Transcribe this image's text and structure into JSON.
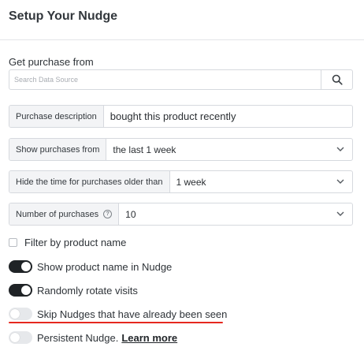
{
  "header": {
    "title": "Setup Your Nudge"
  },
  "purchase_source": {
    "label": "Get purchase from",
    "search_placeholder": "Search Data Source",
    "search_icon": "search-icon"
  },
  "fields": {
    "description": {
      "label": "Purchase description",
      "value": "bought this product recently"
    },
    "show_from": {
      "label": "Show purchases from",
      "value": "the last 1 week"
    },
    "hide_time": {
      "label": "Hide the time for purchases older than",
      "value": "1 week"
    },
    "count": {
      "label": "Number of purchases",
      "value": "10",
      "info_icon": "?"
    }
  },
  "options": {
    "filter_by_name": {
      "label": "Filter by product name",
      "checked": false
    },
    "show_product_name": {
      "label": "Show product name in Nudge",
      "on": true
    },
    "rotate_visits": {
      "label": "Randomly rotate visits",
      "on": true
    },
    "skip_seen": {
      "label": "Skip Nudges that have already been seen",
      "on": false
    },
    "persistent": {
      "label": "Persistent Nudge.",
      "link": "Learn more",
      "on": false
    }
  },
  "colors": {
    "toggle_on": "#1f2326",
    "toggle_off": "#e6e8eb",
    "highlight": "#e5281f"
  }
}
